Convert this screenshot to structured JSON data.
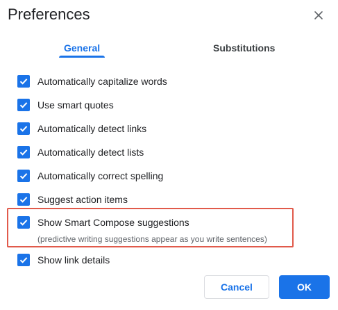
{
  "dialog": {
    "title": "Preferences",
    "close_icon": "close-icon"
  },
  "tabs": [
    {
      "label": "General",
      "active": true
    },
    {
      "label": "Substitutions",
      "active": false
    }
  ],
  "options": [
    {
      "label": "Automatically capitalize words",
      "checked": true
    },
    {
      "label": "Use smart quotes",
      "checked": true
    },
    {
      "label": "Automatically detect links",
      "checked": true
    },
    {
      "label": "Automatically detect lists",
      "checked": true
    },
    {
      "label": "Automatically correct spelling",
      "checked": true
    },
    {
      "label": "Suggest action items",
      "checked": true
    },
    {
      "label": "Show Smart Compose suggestions",
      "checked": true,
      "description": "(predictive writing suggestions appear as you write sentences)"
    },
    {
      "label": "Show link details",
      "checked": true
    }
  ],
  "buttons": {
    "cancel_label": "Cancel",
    "ok_label": "OK"
  },
  "colors": {
    "accent": "#1a73e8",
    "highlight_border": "#e15a4b",
    "text": "#202124",
    "secondary_text": "#5f6368"
  }
}
